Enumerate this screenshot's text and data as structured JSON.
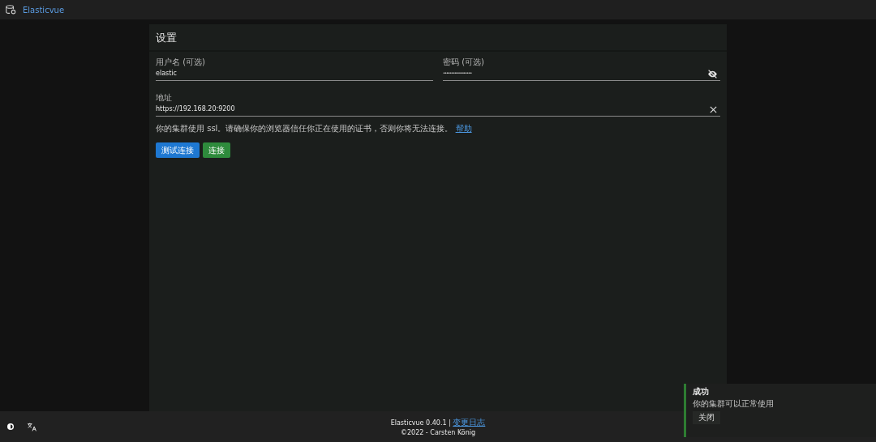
{
  "app_bar": {
    "title": "Elasticvue"
  },
  "settings": {
    "title": "设置",
    "username": {
      "label": "用户名 (可选)",
      "value": "elastic"
    },
    "password": {
      "label": "密码 (可选)",
      "value": "••••••••••••••••••",
      "visible": false
    },
    "uri": {
      "label": "地址",
      "value": "https://192.168.20:9200"
    },
    "ssl_hint": "你的集群使用 ssl。请确保你的浏览器信任你正在使用的证书，否则你将无法连接。",
    "help_link": "帮助",
    "buttons": [
      {
        "label": "测试连接",
        "kind": "primary"
      },
      {
        "label": "连接",
        "kind": "success"
      }
    ]
  },
  "footer": {
    "version": "Elasticvue 0.40.1 |",
    "changelog_link": "变更日志",
    "copyright": "©2022 - Carsten König"
  },
  "toast": {
    "title": "成功",
    "message": "你的集群可以正常使用",
    "close": "关闭",
    "color": "#2e7d32"
  }
}
